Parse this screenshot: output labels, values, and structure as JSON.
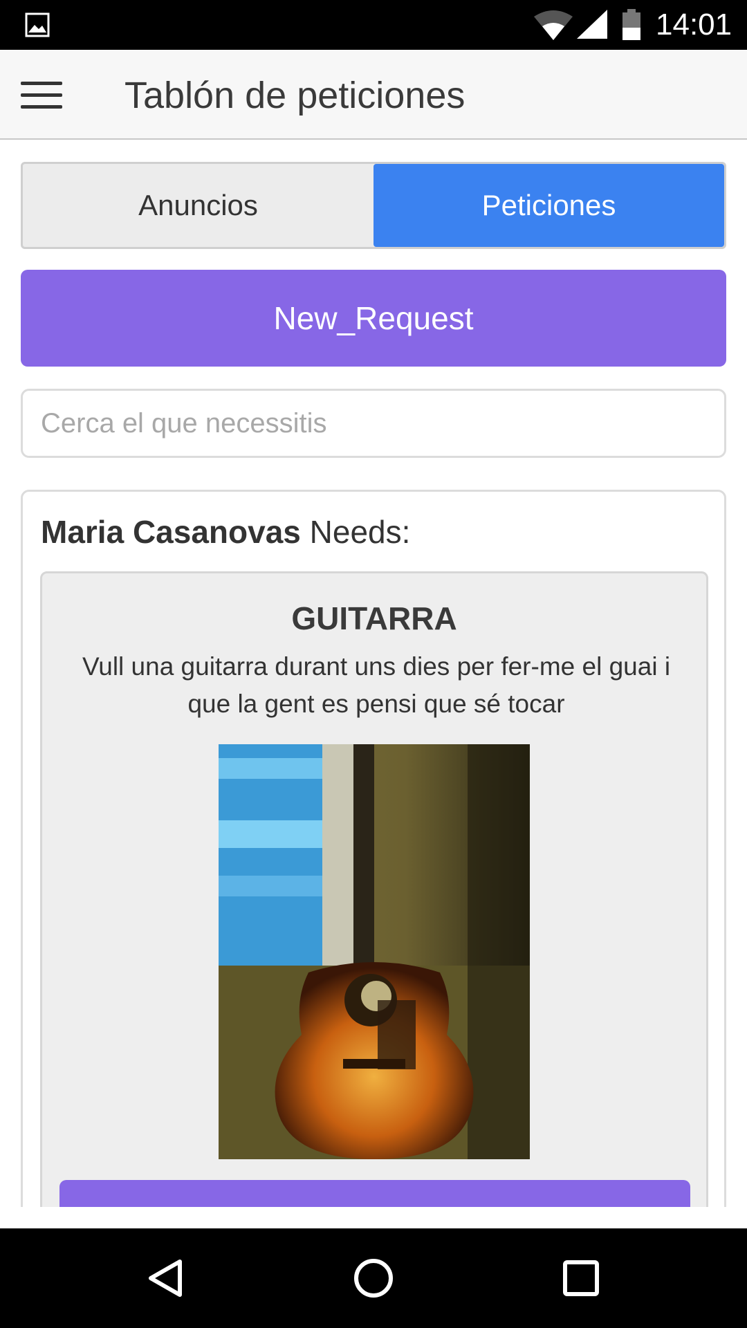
{
  "status_bar": {
    "time": "14:01",
    "icons": [
      "gallery-icon",
      "wifi-icon",
      "signal-icon",
      "battery-icon"
    ]
  },
  "app_bar": {
    "title": "Tablón de peticiones",
    "menu_icon": "hamburger-menu-icon"
  },
  "tabs": [
    {
      "label": "Anuncios",
      "active": false
    },
    {
      "label": "Peticiones",
      "active": true
    }
  ],
  "new_request_label": "New_Request",
  "search": {
    "value": "",
    "placeholder": "Cerca el que necessitis"
  },
  "request_card": {
    "author": "Maria Casanovas",
    "verb": "Needs:",
    "item_title": "GUITARRA",
    "item_description": "Vull una guitarra durant uns dies per fer-me el guai i que la gent es pensi que sé tocar",
    "photo": "acoustic-guitar-photo"
  },
  "nav_bar": {
    "icons": [
      "back-icon",
      "home-icon",
      "recents-icon"
    ]
  },
  "colors": {
    "accent_purple": "#8767e6",
    "active_tab_blue": "#3b82f0"
  }
}
